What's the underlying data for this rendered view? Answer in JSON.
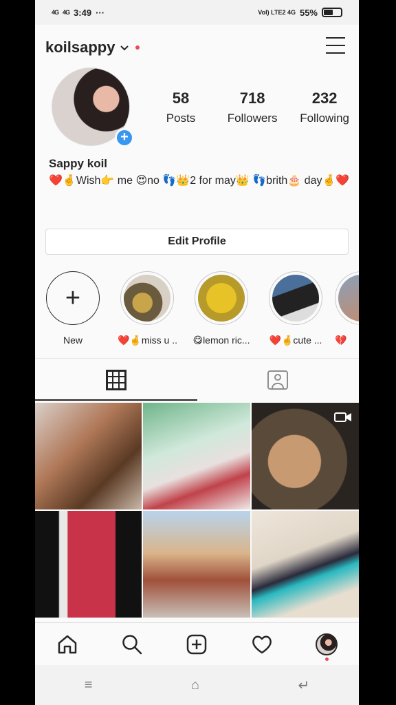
{
  "status_bar": {
    "signal_left": "4G",
    "time": "3:49",
    "dots": "···",
    "network_right": "Vol) LTE2 4G",
    "battery_pct": "55%",
    "battery_level": 0.55
  },
  "header": {
    "username": "koilsappy"
  },
  "profile": {
    "stats": [
      {
        "value": "58",
        "label": "Posts"
      },
      {
        "value": "718",
        "label": "Followers"
      },
      {
        "value": "232",
        "label": "Following"
      }
    ],
    "name": "Sappy koil",
    "bio": "❤️🤞Wish👉 me 😍no 👣👑2 for may👑 👣brith🎂 day🤞❤️",
    "edit_button": "Edit Profile"
  },
  "highlights": [
    {
      "label": "New"
    },
    {
      "label": "❤️🤞miss u ..."
    },
    {
      "label": "😋lemon ric..."
    },
    {
      "label": "❤️🤞cute ..."
    },
    {
      "label": "💔"
    }
  ],
  "colors": {
    "accent": "#3897f0",
    "notification": "#ed4956",
    "text": "#262626",
    "border": "#dbdbdb"
  },
  "icons": {
    "header_menu": "hamburger-icon",
    "tab_grid": "grid-icon",
    "tab_tagged": "tagged-icon",
    "nav": [
      "home-icon",
      "search-icon",
      "add-post-icon",
      "activity-heart-icon",
      "profile-avatar-icon"
    ],
    "system": [
      "recents-icon",
      "home-icon",
      "back-icon"
    ]
  },
  "system_nav": {
    "recents": "≡",
    "home": "⌂",
    "back": "↵"
  }
}
